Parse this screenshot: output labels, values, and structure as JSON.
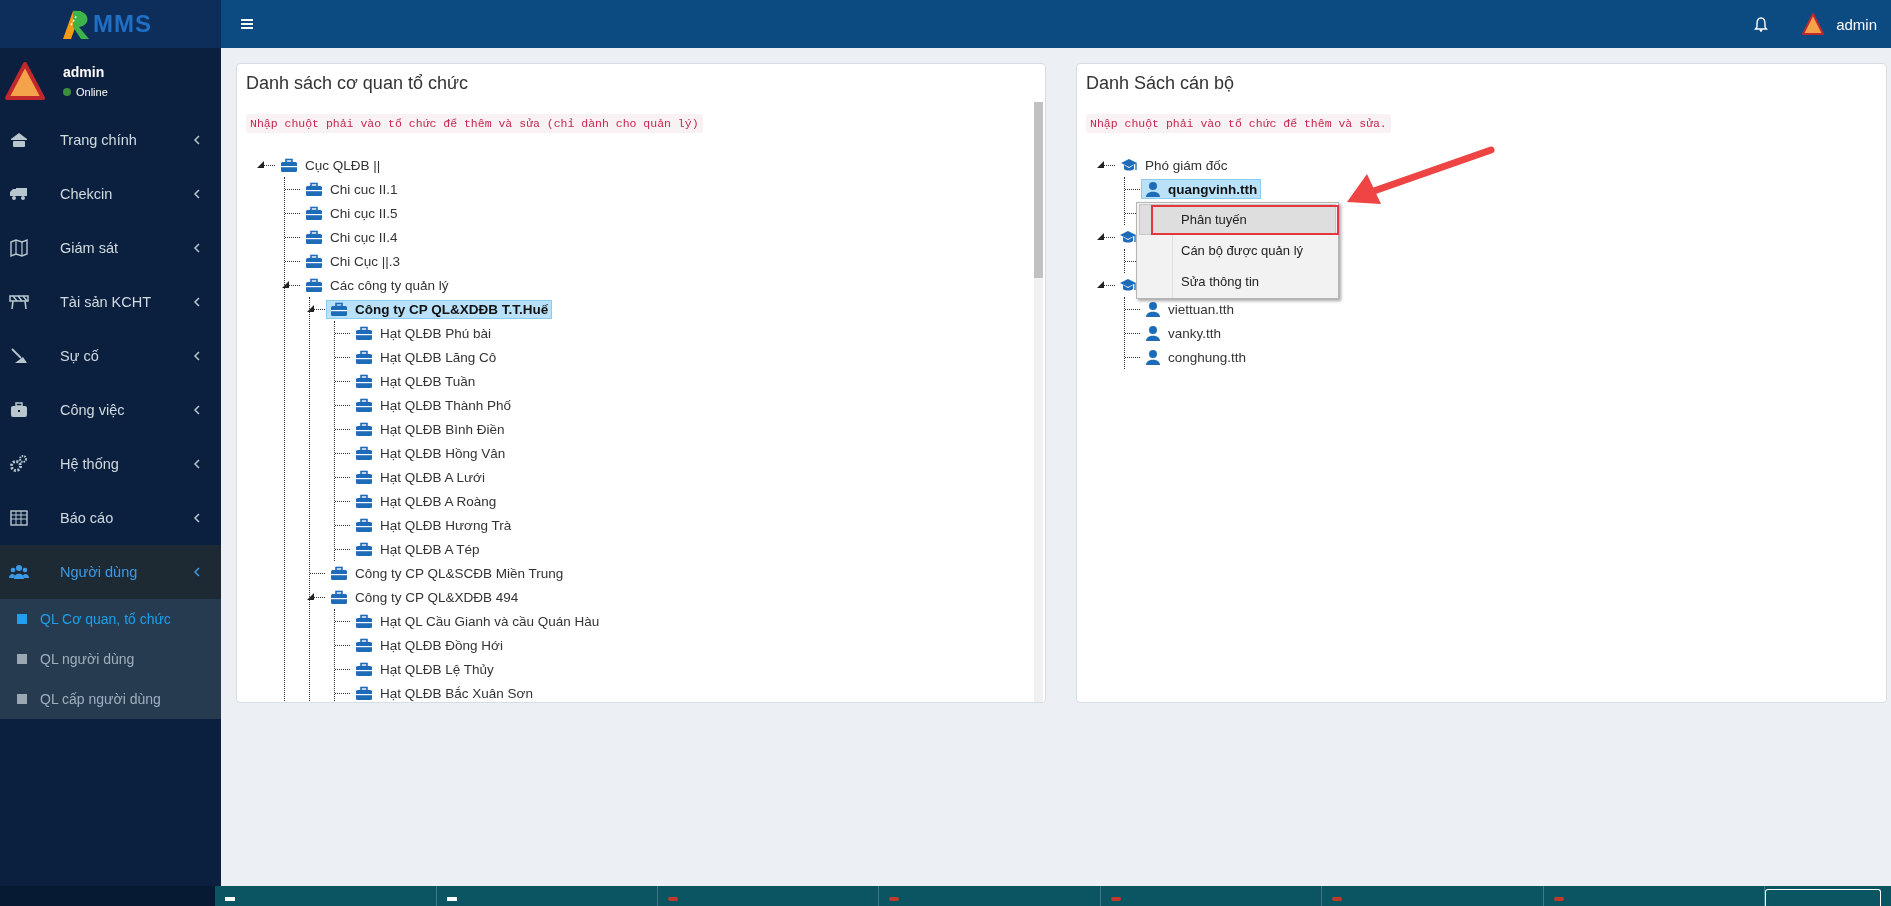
{
  "header": {
    "logo_text": "MMS",
    "user": "admin"
  },
  "sidebar": {
    "user": {
      "name": "admin",
      "status": "Online"
    },
    "items": [
      {
        "label": "Trang chính",
        "selected": false
      },
      {
        "label": "Chekcin",
        "selected": false
      },
      {
        "label": "Giám sát",
        "selected": false
      },
      {
        "label": "Tài sản KCHT",
        "selected": false
      },
      {
        "label": "Sự cố",
        "selected": false
      },
      {
        "label": "Công việc",
        "selected": false
      },
      {
        "label": "Hệ thống",
        "selected": false
      },
      {
        "label": "Báo cáo",
        "selected": false
      },
      {
        "label": "Người dùng",
        "selected": true,
        "expanded": true,
        "children": [
          {
            "label": "QL Cơ quan, tổ chức",
            "selected": true
          },
          {
            "label": "QL người dùng",
            "selected": false
          },
          {
            "label": "QL cấp người dùng",
            "selected": false
          }
        ]
      }
    ]
  },
  "org_panel": {
    "title": "Danh sách cơ quan tổ chức",
    "hint": "Nhập chuột phải vào tổ chức để thêm và sửa (chỉ dành cho quản lý)",
    "tree": [
      {
        "label": "Cục QLĐB ||",
        "selected": false,
        "expanded": true,
        "children": [
          {
            "label": "Chi cuc II.1",
            "selected": false
          },
          {
            "label": "Chi cục II.5",
            "selected": false
          },
          {
            "label": "Chi cục II.4",
            "selected": false
          },
          {
            "label": "Chi Cục ||.3",
            "selected": false
          },
          {
            "label": "Các công ty quản lý",
            "selected": false,
            "expanded": true,
            "children": [
              {
                "label": "Công ty CP QL&XDĐB T.T.Huế",
                "selected": true,
                "expanded": true,
                "children": [
                  {
                    "label": "Hạt QLĐB Phú bài",
                    "selected": false
                  },
                  {
                    "label": "Hạt QLĐB Lăng Cô",
                    "selected": false
                  },
                  {
                    "label": "Hạt QLĐB Tuần",
                    "selected": false
                  },
                  {
                    "label": "Hạt QLĐB Thành Phố",
                    "selected": false
                  },
                  {
                    "label": "Hạt QLĐB Bình Điền",
                    "selected": false
                  },
                  {
                    "label": "Hạt QLĐB Hồng Vân",
                    "selected": false
                  },
                  {
                    "label": "Hạt QLĐB A Lưới",
                    "selected": false
                  },
                  {
                    "label": "Hạt QLĐB A Roàng",
                    "selected": false
                  },
                  {
                    "label": "Hạt QLĐB Hương Trà",
                    "selected": false
                  },
                  {
                    "label": "Hạt QLĐB A Tép",
                    "selected": false
                  }
                ]
              },
              {
                "label": "Công ty CP QL&SCĐB Miền Trung",
                "selected": false
              },
              {
                "label": "Công ty CP QL&XDĐB 494",
                "selected": false,
                "expanded": true,
                "children": [
                  {
                    "label": "Hạt QL Cầu Gianh và cầu Quán Hàu",
                    "selected": false
                  },
                  {
                    "label": "Hạt QLĐB Đồng Hới",
                    "selected": false
                  },
                  {
                    "label": "Hạt QLĐB Lệ Thủy",
                    "selected": false
                  },
                  {
                    "label": "Hạt QLĐB Bắc Xuân Sơn",
                    "selected": false
                  }
                ]
              }
            ]
          }
        ]
      }
    ]
  },
  "staff_panel": {
    "title": "Danh Sách cán bộ",
    "hint": "Nhập chuột phải vào tổ chức để thêm và sửa.",
    "tree": [
      {
        "kind": "group",
        "label": "Phó giám đốc",
        "selected": false,
        "expanded": true,
        "children": [
          {
            "kind": "person",
            "label": "quangvinh.tth",
            "selected": true
          },
          {
            "kind": "person"
          }
        ]
      },
      {
        "kind": "group",
        "expanded": true,
        "children": [
          {
            "kind": "person"
          }
        ]
      },
      {
        "kind": "group",
        "expanded": true,
        "children": [
          {
            "kind": "person",
            "label": "viettuan.tth",
            "selected": false
          },
          {
            "kind": "person",
            "label": "vanky.tth",
            "selected": false
          },
          {
            "kind": "person",
            "label": "conghung.tth",
            "selected": false
          }
        ]
      }
    ],
    "context_menu": {
      "items": [
        {
          "label": "Phân tuyến",
          "selected": true
        },
        {
          "label": "Cán bộ được quản lý",
          "selected": false
        },
        {
          "label": "Sửa thông tin",
          "selected": false
        }
      ]
    }
  }
}
